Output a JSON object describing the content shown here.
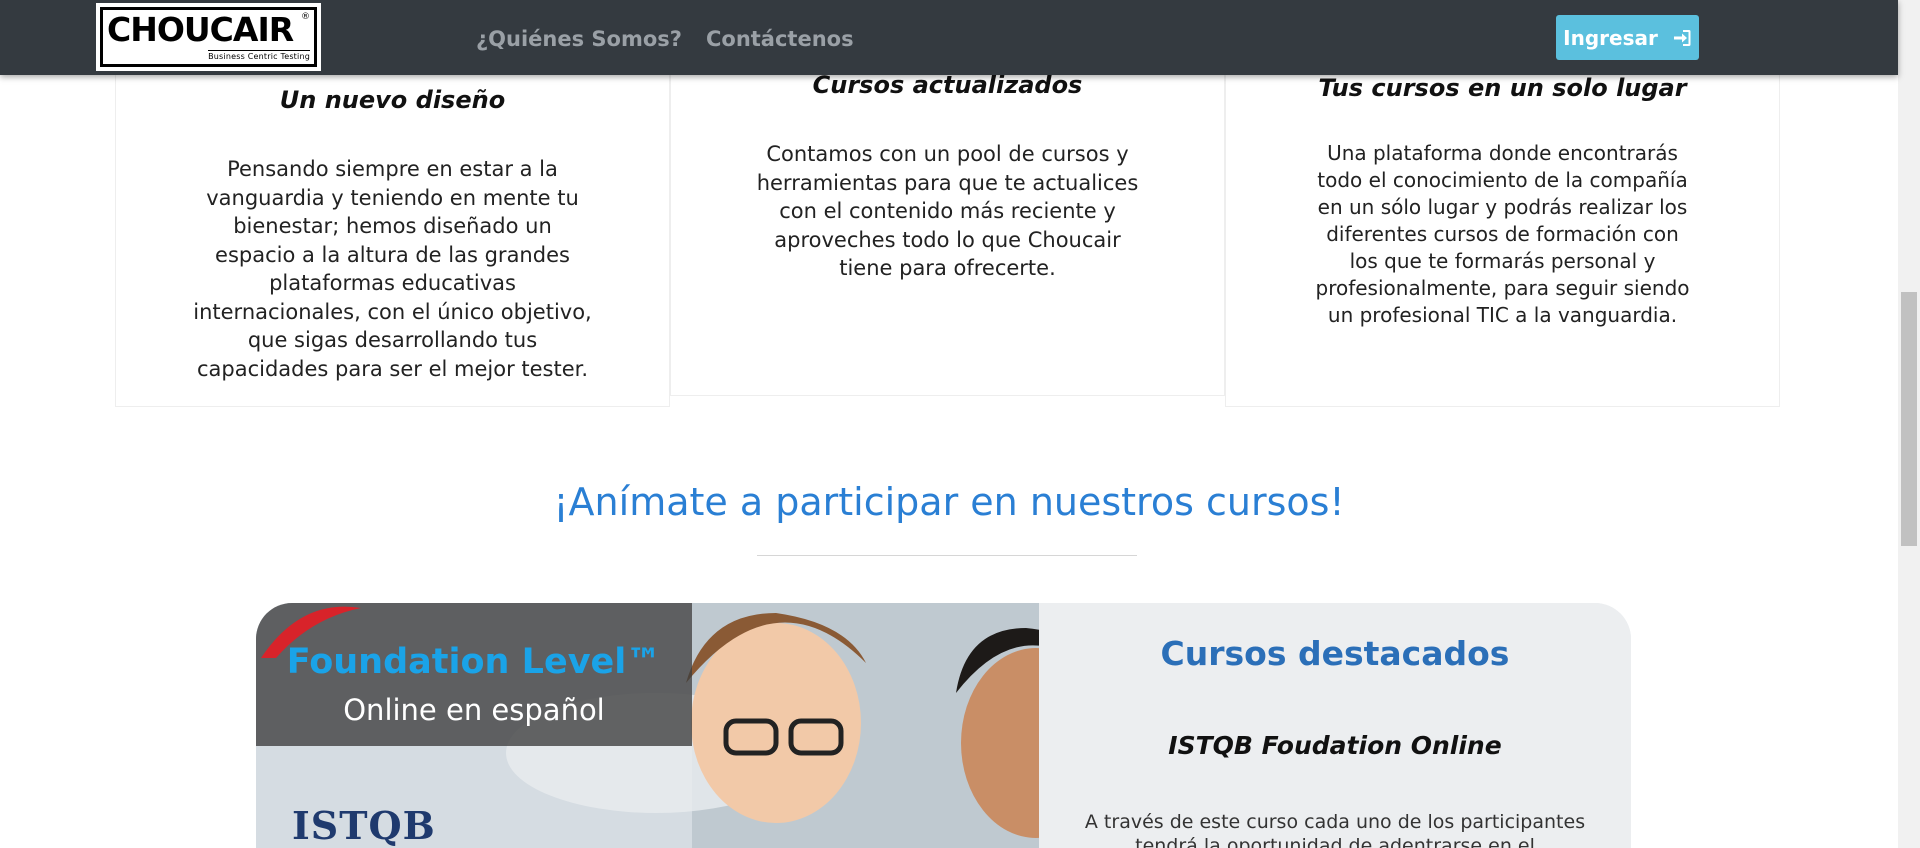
{
  "navbar": {
    "logo_text": "CHOUCAIR",
    "logo_tagline": "Business Centric Testing",
    "links": [
      {
        "label": "¿Quiénes Somos?"
      },
      {
        "label": "Contáctenos"
      }
    ],
    "login_label": "Ingresar",
    "login_icon": "sign-in-icon"
  },
  "features": [
    {
      "title": "Un nuevo diseño",
      "lines": [
        "Pensando siempre en estar a la",
        "vanguardia y teniendo en mente tu",
        "bienestar; hemos diseñado un",
        "espacio a la altura de las grandes",
        "plataformas educativas",
        "internacionales, con el único objetivo,",
        "que sigas desarrollando tus",
        "capacidades para ser el mejor tester."
      ]
    },
    {
      "title": "Cursos actualizados",
      "lines": [
        "Contamos con un pool de cursos y",
        "herramientas para que te actualices",
        "con el contenido más reciente y",
        "aproveches todo lo que Choucair",
        "tiene para ofrecerte."
      ]
    },
    {
      "title": "Tus cursos en un solo lugar",
      "lines": [
        "Una plataforma donde encontrarás",
        "todo el conocimiento de la compañía",
        "en un sólo lugar y podrás realizar los",
        "diferentes cursos de formación con",
        "los que te formarás personal y",
        "profesionalmente, para seguir siendo",
        "un profesional TIC a la vanguardia."
      ]
    }
  ],
  "cta": {
    "title": "¡Anímate a participar en nuestros cursos!"
  },
  "banner": {
    "course_name": "Foundation Level™",
    "course_sub": "Online en español",
    "istqb_logo": "ISTQB",
    "heading": "Cursos destacados",
    "course_title": "ISTQB Foudation Online",
    "description_lines": [
      "A través de este curso cada uno de los participantes",
      "tendrá la oportunidad de adentrarse en el"
    ]
  },
  "colors": {
    "navbar_bg": "#343a40",
    "login_button": "#5bc0de",
    "cta_blue": "#2a7fd4",
    "banner_heading": "#2b6fb8",
    "foundation_blue": "#1aa3e8"
  }
}
